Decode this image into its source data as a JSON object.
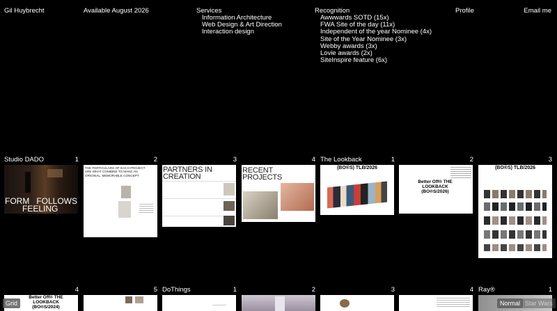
{
  "header": {
    "name": "Gil Huybrecht",
    "availability": "Available August 2026",
    "services_label": "Services",
    "services": [
      "Information Architecture",
      "Web Design & Art Direction",
      "Interaction design"
    ],
    "recognition_label": "Recognition",
    "recognition": [
      "Awwwards SOTD (15x)",
      "FWA Site of the day (11x)",
      "Independent of the year Nominee (4x)",
      "Site of the Year Nominee (3x)",
      "Webby awards (3x)",
      "Lovie awards (2x)",
      "SiteInspire feature (6x)"
    ],
    "profile_link": "Profile",
    "email_link": "Email me"
  },
  "projects": {
    "dado": {
      "title": "Studio DADO",
      "numbers": [
        "1",
        "2",
        "3",
        "4"
      ],
      "slide1_left": "FORM",
      "slide1_right": "FOLLOWS",
      "slide1_bottom": "FEELING",
      "slide2_text": "THE PARTICULARS OF EACH PROJECT ARE WHAT COMBINE TO MAKE AN ORIGINAL, MEMORABLE CONCEPT.",
      "slide3_text": "PARTNERS IN CREATION",
      "slide4_text": "RECENT PROJECTS"
    },
    "lookback": {
      "title": "The Lookback",
      "numbers": [
        "1",
        "2",
        "3"
      ],
      "slide1_text": "(BO®S) TLB/2026",
      "slide2_text": "Better Off® THE LOOKBACK (BO®S/2026)",
      "slide3_text": "(BO®S) TLB/2026"
    },
    "row3": {
      "first_number": "4",
      "first_text": "Better Off® THE LOOKBACK (BO®S/2024)",
      "second_number": "5",
      "dothings_title": "DoThings",
      "dothings_numbers": [
        "1",
        "2",
        "3",
        "4"
      ],
      "ray_title": "Ray®",
      "ray_number": "1"
    }
  },
  "controls": {
    "grid_label": "Grid",
    "normal_label": "Normal",
    "star_wars_label": "Star Wars"
  }
}
